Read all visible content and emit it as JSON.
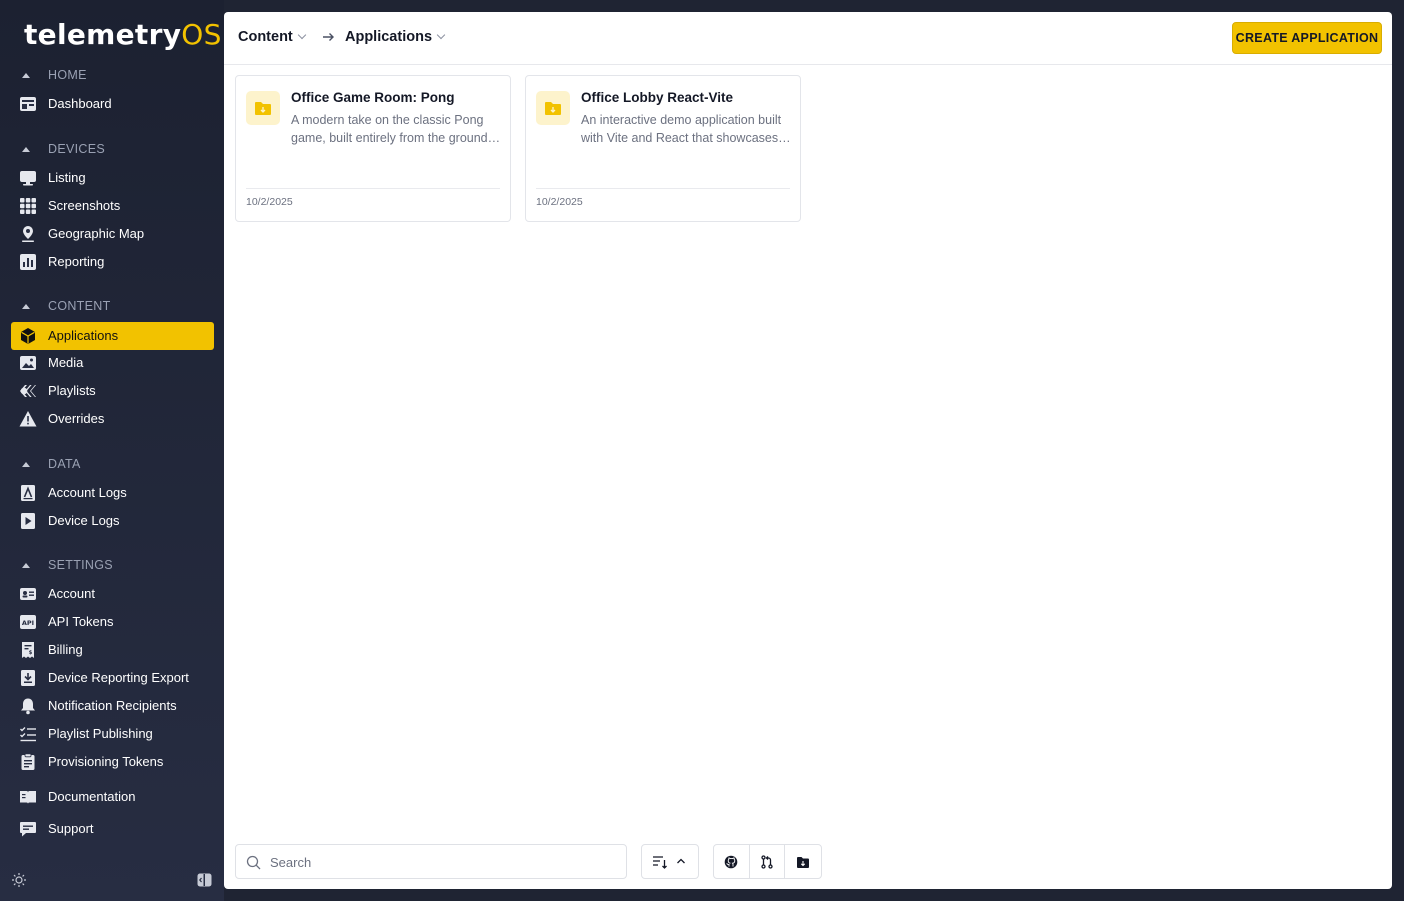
{
  "brand": {
    "name_main": "telemetry",
    "name_accent": "OS"
  },
  "sidebar": {
    "sections": [
      {
        "label": "HOME"
      },
      {
        "label": "DEVICES"
      },
      {
        "label": "CONTENT"
      },
      {
        "label": "DATA"
      },
      {
        "label": "SETTINGS"
      }
    ],
    "items": [
      {
        "label": "Dashboard",
        "icon": "dashboard-icon"
      },
      {
        "label": "Listing",
        "icon": "monitor-icon"
      },
      {
        "label": "Screenshots",
        "icon": "grid-icon"
      },
      {
        "label": "Geographic Map",
        "icon": "map-pin-icon"
      },
      {
        "label": "Reporting",
        "icon": "bar-chart-icon"
      },
      {
        "label": "Applications",
        "icon": "cube-icon",
        "active": true
      },
      {
        "label": "Media",
        "icon": "image-icon"
      },
      {
        "label": "Playlists",
        "icon": "playlist-icon"
      },
      {
        "label": "Overrides",
        "icon": "warning-icon"
      },
      {
        "label": "Account Logs",
        "icon": "account-log-icon"
      },
      {
        "label": "Device Logs",
        "icon": "device-log-icon"
      },
      {
        "label": "Account",
        "icon": "id-card-icon"
      },
      {
        "label": "API Tokens",
        "icon": "api-icon"
      },
      {
        "label": "Billing",
        "icon": "receipt-icon"
      },
      {
        "label": "Device Reporting Export",
        "icon": "download-icon"
      },
      {
        "label": "Notification Recipients",
        "icon": "bell-icon"
      },
      {
        "label": "Playlist Publishing",
        "icon": "checklist-icon"
      },
      {
        "label": "Provisioning Tokens",
        "icon": "clipboard-icon"
      },
      {
        "label": "Documentation",
        "icon": "book-icon"
      },
      {
        "label": "Support",
        "icon": "chat-icon"
      }
    ]
  },
  "topbar": {
    "breadcrumb": [
      "Content",
      "Applications"
    ],
    "create_label": "CREATE APPLICATION"
  },
  "cards": [
    {
      "title": "Office Game Room: Pong",
      "description": "A modern take on the classic Pong game, built entirely from the ground up",
      "date": "10/2/2025"
    },
    {
      "title": "Office Lobby React-Vite",
      "description": "An interactive demo application built with Vite and React that showcases features",
      "date": "10/2/2025"
    }
  ],
  "toolbar": {
    "search_placeholder": "Search"
  },
  "colors": {
    "accent": "#f2c200",
    "sidebar_bg": "#1f2433",
    "text_dark": "#141826",
    "muted": "#6c7180"
  }
}
